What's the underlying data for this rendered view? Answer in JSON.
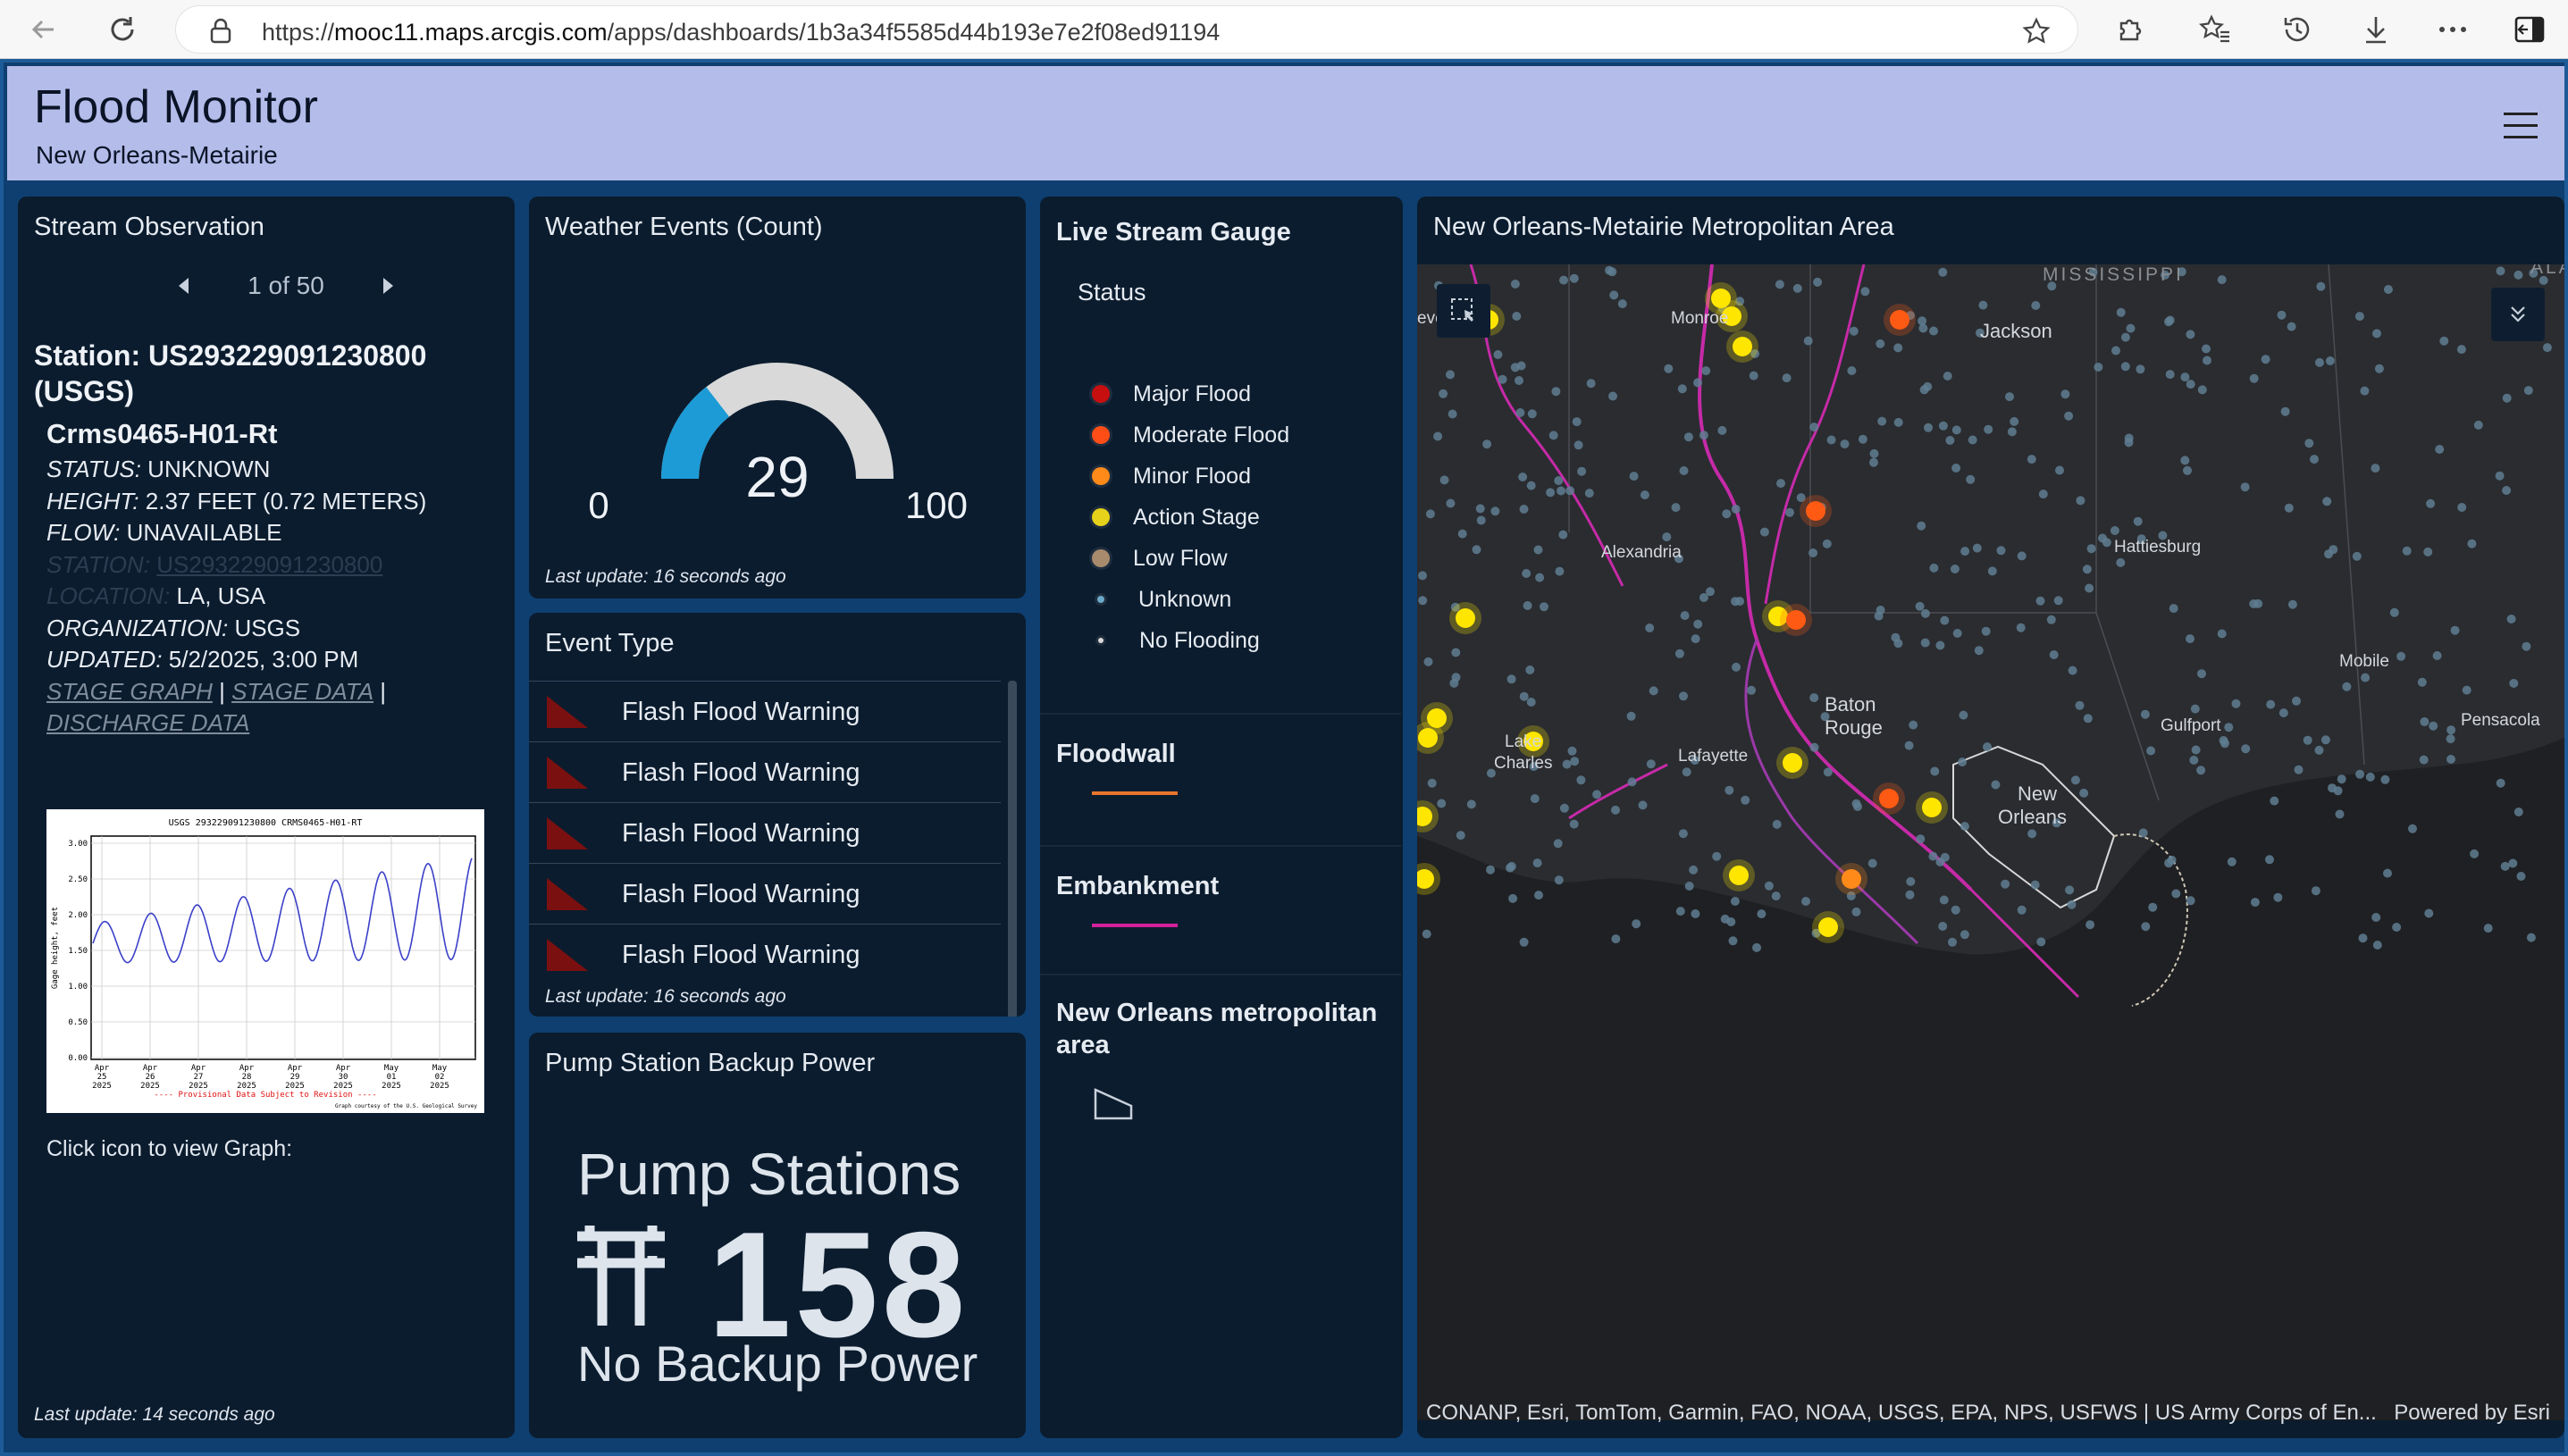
{
  "browser": {
    "url_scheme": "https://",
    "url_host": "mooc11.maps.arcgis.com",
    "url_path": "/apps/dashboards/1b3a34f5585d44b193e7e2f08ed91194"
  },
  "header": {
    "title": "Flood Monitor",
    "subtitle": "New Orleans-Metairie"
  },
  "stream": {
    "title": "Stream Observation",
    "pager": "1 of 50",
    "station": "Station: US293229091230800 (USGS)",
    "site": "Crms0465-H01-Rt",
    "status_key": "STATUS:",
    "status_val": "UNKNOWN",
    "height_key": "HEIGHT:",
    "height_val": "2.37 FEET (0.72 METERS)",
    "flow_key": "FLOW:",
    "flow_val": "UNAVAILABLE",
    "station_key": "STATION:",
    "station_val": "US293229091230800",
    "location_key": "LOCATION:",
    "location_val": "LA, USA",
    "org_key": "ORGANIZATION:",
    "org_val": "USGS",
    "updated_key": "UPDATED:",
    "updated_val": "5/2/2025, 3:00 PM",
    "link_stage_graph": "STAGE GRAPH",
    "link_stage_data": "STAGE DATA",
    "link_discharge": "DISCHARGE DATA",
    "sep": "|",
    "graph_caption": "Click icon to view Graph:",
    "last_update": "Last update: 14 seconds ago",
    "graph": {
      "title": "USGS 293229091230800 CRMS0465-H01-RT",
      "ylabel": "Gage height, feet",
      "yticks": [
        "3.00",
        "2.50",
        "2.00",
        "1.50",
        "1.00",
        "0.50",
        "0.00"
      ],
      "xticks": [
        [
          "Apr",
          "25",
          "2025"
        ],
        [
          "Apr",
          "26",
          "2025"
        ],
        [
          "Apr",
          "27",
          "2025"
        ],
        [
          "Apr",
          "28",
          "2025"
        ],
        [
          "Apr",
          "29",
          "2025"
        ],
        [
          "Apr",
          "30",
          "2025"
        ],
        [
          "May",
          "01",
          "2025"
        ],
        [
          "May",
          "02",
          "2025"
        ]
      ],
      "footer": "---- Provisional Data Subject to Revision ----",
      "credit": "Graph courtesy of the U.S. Geological Survey"
    }
  },
  "weather": {
    "title": "Weather Events (Count)",
    "value": 29,
    "min": 0,
    "max": 100,
    "value_text": "29",
    "min_text": "0",
    "max_text": "100",
    "last_update": "Last update: 16 seconds ago",
    "color_fill": "#1c9bd6",
    "color_track": "#d9d9d9"
  },
  "events": {
    "title": "Event Type",
    "items": [
      {
        "label": "Flash Flood Warning"
      },
      {
        "label": "Flash Flood Warning"
      },
      {
        "label": "Flash Flood Warning"
      },
      {
        "label": "Flash Flood Warning"
      },
      {
        "label": "Flash Flood Warning"
      }
    ],
    "last_update": "Last update: 16 seconds ago",
    "flag_color": "#7a1010"
  },
  "pump": {
    "title": "Pump Station Backup Power",
    "heading": "Pump Stations",
    "value": "158",
    "footer": "No Backup Power"
  },
  "legend": {
    "title": "Live Stream Gauge",
    "status_label": "Status",
    "items": [
      {
        "label": "Major Flood",
        "color": "#c80f0f"
      },
      {
        "label": "Moderate Flood",
        "color": "#ff4d17"
      },
      {
        "label": "Minor Flood",
        "color": "#ff8a1a"
      },
      {
        "label": "Action Stage",
        "color": "#e6d21a"
      },
      {
        "label": "Low Flow",
        "color": "#a88b6c"
      },
      {
        "label": "Unknown",
        "color": "#6aa9c9"
      },
      {
        "label": "No Flooding",
        "color": "#d9d9d9"
      }
    ],
    "floodwall": "Floodwall",
    "floodwall_color": "#e8762c",
    "embankment": "Embankment",
    "embankment_color": "#d6219c",
    "metro": "New Orleans metropolitan area"
  },
  "map": {
    "title": "New Orleans-Metairie Metropolitan Area",
    "attribution": "CONANP, Esri, TomTom, Garmin, FAO, NOAA, USGS, EPA, NPS, USFWS | US Army Corps of En...",
    "powered": "Powered by Esri",
    "labels": {
      "mississippi": "MISSISSIPPI",
      "ala": "ALA",
      "jackson": "Jackson",
      "monroe": "Monroe",
      "alexandria": "Alexandria",
      "hattiesburg": "Hattiesburg",
      "mobile": "Mobile",
      "pensacola": "Pensacola",
      "baton": "Baton",
      "rouge": "Rouge",
      "gulfport": "Gulfport",
      "lafayette": "Lafayette",
      "lake": "Lake",
      "charles": "Charles",
      "new": "New",
      "orleans": "Orleans",
      "eve": "eve"
    }
  }
}
